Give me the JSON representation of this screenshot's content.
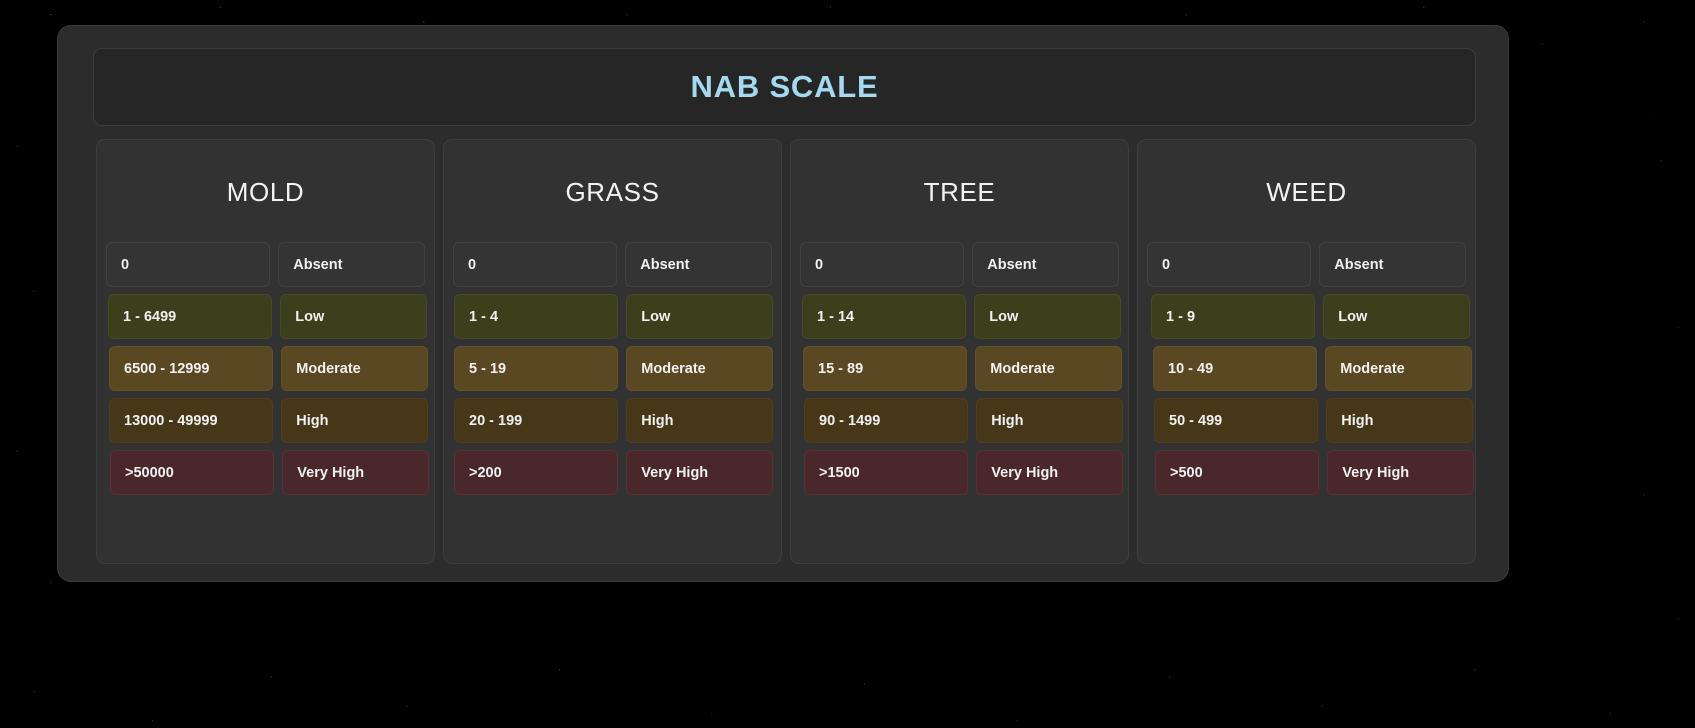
{
  "header": {
    "title": "NAB SCALE",
    "title_color": "#a4d9ef"
  },
  "severity_colors": {
    "absent": "#343434",
    "low": "#3c3f1c",
    "moderate": "#5a4822",
    "high": "#453718",
    "very_high": "#4a272b"
  },
  "columns": [
    {
      "name": "MOLD",
      "rows": [
        {
          "range": "0",
          "label": "Absent",
          "severity": "absent"
        },
        {
          "range": "1 - 6499",
          "label": "Low",
          "severity": "low"
        },
        {
          "range": "6500 - 12999",
          "label": "Moderate",
          "severity": "moderate"
        },
        {
          "range": "13000 - 49999",
          "label": "High",
          "severity": "high"
        },
        {
          "range": ">50000",
          "label": "Very High",
          "severity": "very_high"
        }
      ]
    },
    {
      "name": "GRASS",
      "rows": [
        {
          "range": "0",
          "label": "Absent",
          "severity": "absent"
        },
        {
          "range": "1 - 4",
          "label": "Low",
          "severity": "low"
        },
        {
          "range": "5 - 19",
          "label": "Moderate",
          "severity": "moderate"
        },
        {
          "range": "20 - 199",
          "label": "High",
          "severity": "high"
        },
        {
          "range": ">200",
          "label": "Very High",
          "severity": "very_high"
        }
      ]
    },
    {
      "name": "TREE",
      "rows": [
        {
          "range": "0",
          "label": "Absent",
          "severity": "absent"
        },
        {
          "range": "1 - 14",
          "label": "Low",
          "severity": "low"
        },
        {
          "range": "15 - 89",
          "label": "Moderate",
          "severity": "moderate"
        },
        {
          "range": "90 - 1499",
          "label": "High",
          "severity": "high"
        },
        {
          "range": ">1500",
          "label": "Very High",
          "severity": "very_high"
        }
      ]
    },
    {
      "name": "WEED",
      "rows": [
        {
          "range": "0",
          "label": "Absent",
          "severity": "absent"
        },
        {
          "range": "1 - 9",
          "label": "Low",
          "severity": "low"
        },
        {
          "range": "10 - 49",
          "label": "Moderate",
          "severity": "moderate"
        },
        {
          "range": "50 - 499",
          "label": "High",
          "severity": "high"
        },
        {
          "range": ">500",
          "label": "Very High",
          "severity": "very_high"
        }
      ]
    }
  ]
}
